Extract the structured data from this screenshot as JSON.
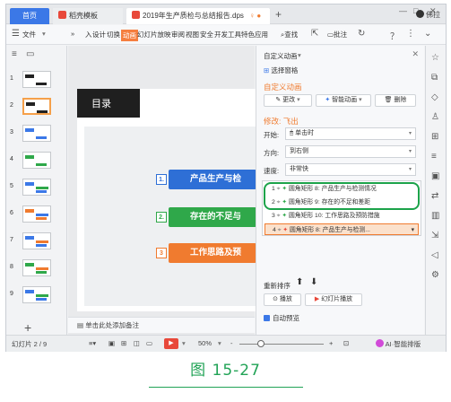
{
  "titlebar": {
    "tab_home": "首页",
    "tab_daoke": "稻壳模板",
    "tab_doc": "2019年生产质检与总结报告.dps",
    "tab_doc_suffix": "♀ ●",
    "add_tab": "+",
    "user": "佛拉",
    "win_min": "—",
    "win_restore": "□",
    "win_close": "✕",
    "colors": {
      "home": "#3b78e7",
      "doc_badge": "#e8483a",
      "daoke_badge": "#e8483a"
    }
  },
  "menubar": {
    "file": "文件",
    "more": "»",
    "items": [
      "入",
      "设计",
      "切换",
      "动画",
      "幻灯片放映",
      "审阅",
      "视图",
      "安全",
      "开发工具",
      "特色应用"
    ],
    "active": "动画",
    "search": "查找",
    "comment": "批注",
    "share_hint": "？"
  },
  "thumbs": [
    {
      "num": "1"
    },
    {
      "num": "2"
    },
    {
      "num": "3"
    },
    {
      "num": "4"
    },
    {
      "num": "5"
    },
    {
      "num": "6"
    },
    {
      "num": "7"
    },
    {
      "num": "8"
    },
    {
      "num": "9"
    }
  ],
  "slide": {
    "heading": "目录",
    "items": [
      {
        "num": "1.",
        "text": "产品生产与检",
        "color": "#2e6fd6"
      },
      {
        "num": "2.",
        "text": "存在的不足与",
        "color": "#2fa84a"
      },
      {
        "num": "3",
        "text": "工作思路及预",
        "color": "#f07b2f"
      }
    ]
  },
  "notes_placeholder": "单击此处添加备注",
  "pane": {
    "title": "自定义动画",
    "select_pane": "选择窗格",
    "section_custom": "自定义动画",
    "change_btn": "更改",
    "smart_btn": "智能动画",
    "delete_btn": "删除",
    "modify_label": "修改: 飞出",
    "start_label": "开始:",
    "start_value": "单击时",
    "direction_label": "方向:",
    "direction_value": "到右侧",
    "speed_label": "速度:",
    "speed_value": "非常快",
    "anim_items": [
      {
        "index": "1",
        "text": "圆角矩形 8: 产品生产与检测情况"
      },
      {
        "index": "2",
        "text": "圆角矩形 9: 存在的不足和差距"
      },
      {
        "index": "3",
        "text": "圆角矩形 10: 工作思路及预防措施"
      },
      {
        "index": "4",
        "text": "圆角矩形 8: 产品生产与检测..."
      }
    ],
    "reorder_label": "重新排序",
    "play_btn": "播放",
    "slideshow_btn": "幻灯片播放",
    "autopreview": "自动预览"
  },
  "statusbar": {
    "slide_counter": "幻灯片 2 / 9",
    "zoom": "50%",
    "zoom_minus": "-",
    "zoom_plus": "+",
    "ai_label": "AI·智能排版"
  },
  "caption": "图 15-27"
}
